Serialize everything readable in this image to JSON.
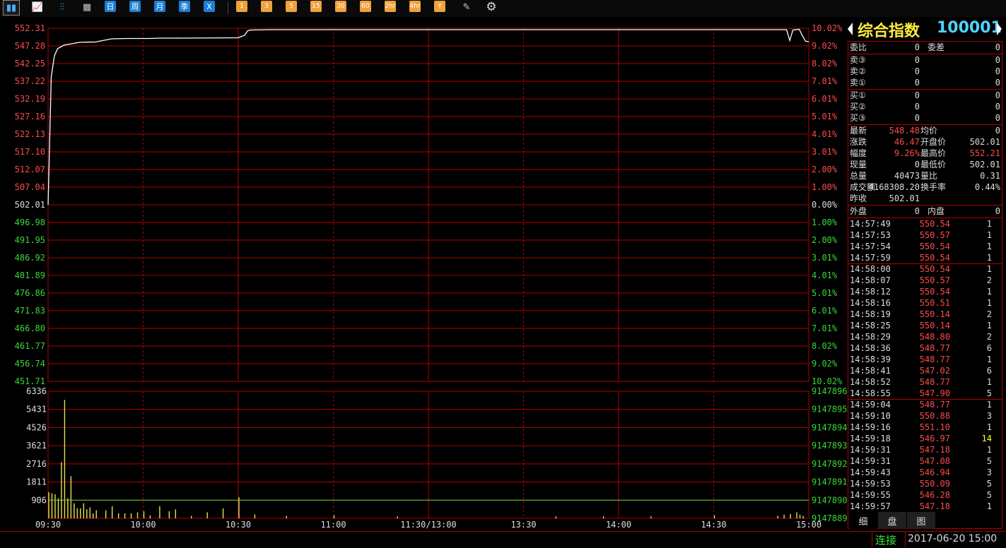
{
  "toolbar": {
    "items": [
      {
        "name": "bar-chart-icon",
        "label": "▮▮",
        "kind": "icon"
      },
      {
        "name": "line-chart-icon",
        "label": "📈",
        "kind": "icon"
      },
      {
        "name": "candlestick-icon",
        "label": "⫶⫶",
        "kind": "icon"
      },
      {
        "name": "calendar-icon",
        "label": "▦",
        "kind": "icon"
      },
      {
        "name": "period-day-button",
        "label": "日",
        "kind": "blue"
      },
      {
        "name": "period-week-button",
        "label": "周",
        "kind": "blue"
      },
      {
        "name": "period-month-button",
        "label": "月",
        "kind": "blue"
      },
      {
        "name": "period-quarter-button",
        "label": "季",
        "kind": "blue"
      },
      {
        "name": "period-x-button",
        "label": "X",
        "kind": "blue"
      },
      {
        "name": "period-1min-button",
        "label": "1",
        "kind": "orange"
      },
      {
        "name": "period-3min-button",
        "label": "3",
        "kind": "orange"
      },
      {
        "name": "period-5min-button",
        "label": "5",
        "kind": "orange"
      },
      {
        "name": "period-15min-button",
        "label": "15",
        "kind": "orange"
      },
      {
        "name": "period-30min-button",
        "label": "30",
        "kind": "orange"
      },
      {
        "name": "period-60min-button",
        "label": "60",
        "kind": "orange"
      },
      {
        "name": "period-2hr-button",
        "label": "2hr",
        "kind": "orange"
      },
      {
        "name": "period-4hr-button",
        "label": "4hr",
        "kind": "orange"
      },
      {
        "name": "period-year-button",
        "label": "Y",
        "kind": "orange"
      },
      {
        "name": "edit-icon",
        "label": "✎",
        "kind": "icon"
      },
      {
        "name": "gear-icon",
        "label": "⚙",
        "kind": "icon"
      }
    ]
  },
  "chart_data": [
    {
      "type": "line",
      "y_left_ticks": [
        "552.31",
        "547.28",
        "542.25",
        "537.22",
        "532.19",
        "527.16",
        "522.13",
        "517.10",
        "512.07",
        "507.04",
        "502.01",
        "496.98",
        "491.95",
        "486.92",
        "481.89",
        "476.86",
        "471.83",
        "466.80",
        "461.77",
        "456.74",
        "451.71"
      ],
      "y_right_ticks": [
        "10.02%",
        "9.02%",
        "8.02%",
        "7.01%",
        "6.01%",
        "5.01%",
        "4.01%",
        "3.01%",
        "2.00%",
        "1.00%",
        "0.00%",
        "1.00%",
        "2.00%",
        "3.01%",
        "4.01%",
        "5.01%",
        "6.01%",
        "7.01%",
        "8.02%",
        "9.02%",
        "10.02%"
      ],
      "ylim": [
        451.71,
        552.31
      ],
      "base_price": 502.01,
      "minutes": [
        0,
        1,
        2,
        3,
        5,
        7,
        10,
        15,
        20,
        25,
        30,
        32,
        35,
        40,
        60,
        62,
        63,
        64,
        70,
        90,
        120,
        150,
        180,
        195,
        200,
        210,
        230,
        233,
        234,
        235,
        237,
        238,
        239,
        240
      ],
      "prices": [
        502.01,
        538.5,
        544.5,
        546.5,
        547.5,
        547.8,
        548.3,
        548.4,
        549.3,
        549.4,
        549.4,
        549.4,
        549.5,
        549.5,
        549.6,
        550.3,
        551.6,
        551.8,
        551.9,
        551.9,
        551.9,
        551.9,
        551.9,
        551.9,
        551.9,
        551.9,
        551.9,
        551.9,
        548.8,
        551.8,
        552.0,
        550.2,
        548.6,
        548.48
      ]
    },
    {
      "type": "bar",
      "y_left_ticks": [
        "6336",
        "5431",
        "4526",
        "3621",
        "2716",
        "1811",
        "906"
      ],
      "y_right_ticks": [
        "9147896",
        "9147895",
        "9147894",
        "9147893",
        "9147892",
        "9147891",
        "9147890",
        "9147889"
      ],
      "ylim": [
        0,
        6336
      ],
      "bar_minutes": [
        0,
        1,
        2,
        3,
        4,
        5,
        6,
        7,
        8,
        9,
        10,
        11,
        12,
        13,
        14,
        15,
        18,
        20,
        22,
        24,
        26,
        28,
        30,
        32,
        35,
        38,
        40,
        45,
        50,
        55,
        60,
        65,
        75,
        90,
        110,
        160,
        175,
        190,
        210,
        230,
        232,
        234,
        236,
        237,
        238
      ],
      "bar_values": [
        1300,
        1250,
        1200,
        1000,
        2800,
        5900,
        1000,
        2100,
        750,
        500,
        500,
        750,
        450,
        550,
        250,
        400,
        400,
        600,
        250,
        250,
        250,
        300,
        350,
        150,
        600,
        350,
        450,
        120,
        300,
        500,
        1050,
        200,
        120,
        150,
        100,
        100,
        100,
        100,
        150,
        130,
        180,
        220,
        300,
        180,
        120
      ],
      "avg_line_value": 905,
      "x_ticks": [
        "09:30",
        "10:00",
        "10:30",
        "11:00",
        "11:30/13:00",
        "13:30",
        "14:00",
        "14:30",
        "15:00"
      ]
    }
  ],
  "quote": {
    "name": "综合指数",
    "code": "100001",
    "weibi_label": "委比",
    "weibi_value": "0",
    "weicha_label": "委差",
    "weicha_value": "0",
    "asks": [
      {
        "label": "卖③",
        "price": "0",
        "vol": "0"
      },
      {
        "label": "卖②",
        "price": "0",
        "vol": "0"
      },
      {
        "label": "卖①",
        "price": "0",
        "vol": "0"
      }
    ],
    "bids": [
      {
        "label": "买①",
        "price": "0",
        "vol": "0"
      },
      {
        "label": "买②",
        "price": "0",
        "vol": "0"
      },
      {
        "label": "买③",
        "price": "0",
        "vol": "0"
      }
    ],
    "stats": [
      {
        "l1": "最新",
        "v1": "548.48",
        "c1": "red",
        "l2": "均价",
        "v2": "0",
        "c2": "wht"
      },
      {
        "l1": "涨跌",
        "v1": "46.47",
        "c1": "red",
        "l2": "开盘价",
        "v2": "502.01",
        "c2": "wht"
      },
      {
        "l1": "幅度",
        "v1": "9.26%",
        "c1": "red",
        "l2": "最高价",
        "v2": "552.21",
        "c2": "red"
      },
      {
        "l1": "现量",
        "v1": "0",
        "c1": "wht",
        "l2": "最低价",
        "v2": "502.01",
        "c2": "wht"
      },
      {
        "l1": "总量",
        "v1": "40473",
        "c1": "wht",
        "l2": "量比",
        "v2": "0.31",
        "c2": "wht"
      },
      {
        "l1": "成交额",
        "v1": "4168308.20",
        "c1": "wht",
        "l2": "换手率",
        "v2": "0.44%",
        "c2": "wht"
      },
      {
        "l1": "昨收",
        "v1": "502.01",
        "c1": "wht",
        "l2": "",
        "v2": "",
        "c2": "wht"
      }
    ],
    "outer_label": "外盘",
    "outer_value": "0",
    "inner_label": "内盘",
    "inner_value": "0",
    "ticks": [
      {
        "t": "14:57:49",
        "p": "550.54",
        "v": "1",
        "vc": "wht"
      },
      {
        "t": "14:57:53",
        "p": "550.57",
        "v": "1",
        "vc": "wht"
      },
      {
        "t": "14:57:54",
        "p": "550.54",
        "v": "1",
        "vc": "wht"
      },
      {
        "t": "14:57:59",
        "p": "550.54",
        "v": "1",
        "vc": "wht"
      },
      {
        "t": "14:58:00",
        "p": "550.54",
        "v": "1",
        "vc": "wht"
      },
      {
        "t": "14:58:07",
        "p": "550.57",
        "v": "2",
        "vc": "wht"
      },
      {
        "t": "14:58:12",
        "p": "550.54",
        "v": "1",
        "vc": "wht"
      },
      {
        "t": "14:58:16",
        "p": "550.51",
        "v": "1",
        "vc": "wht"
      },
      {
        "t": "14:58:19",
        "p": "550.14",
        "v": "2",
        "vc": "wht"
      },
      {
        "t": "14:58:25",
        "p": "550.14",
        "v": "1",
        "vc": "wht"
      },
      {
        "t": "14:58:29",
        "p": "548.80",
        "v": "2",
        "vc": "wht"
      },
      {
        "t": "14:58:36",
        "p": "548.77",
        "v": "6",
        "vc": "wht"
      },
      {
        "t": "14:58:39",
        "p": "548.77",
        "v": "1",
        "vc": "wht"
      },
      {
        "t": "14:58:41",
        "p": "547.02",
        "v": "6",
        "vc": "wht"
      },
      {
        "t": "14:58:52",
        "p": "548.77",
        "v": "1",
        "vc": "wht"
      },
      {
        "t": "14:58:55",
        "p": "547.90",
        "v": "5",
        "vc": "wht"
      },
      {
        "t": "14:59:04",
        "p": "548.77",
        "v": "1",
        "vc": "wht"
      },
      {
        "t": "14:59:10",
        "p": "550.88",
        "v": "3",
        "vc": "wht"
      },
      {
        "t": "14:59:16",
        "p": "551.10",
        "v": "1",
        "vc": "wht"
      },
      {
        "t": "14:59:18",
        "p": "546.97",
        "v": "14",
        "vc": "yel"
      },
      {
        "t": "14:59:31",
        "p": "547.18",
        "v": "1",
        "vc": "wht"
      },
      {
        "t": "14:59:31",
        "p": "547.08",
        "v": "5",
        "vc": "wht"
      },
      {
        "t": "14:59:43",
        "p": "546.94",
        "v": "3",
        "vc": "wht"
      },
      {
        "t": "14:59:53",
        "p": "550.09",
        "v": "5",
        "vc": "wht"
      },
      {
        "t": "14:59:55",
        "p": "546.28",
        "v": "5",
        "vc": "wht"
      },
      {
        "t": "14:59:57",
        "p": "547.18",
        "v": "1",
        "vc": "wht"
      }
    ]
  },
  "tabs": [
    {
      "name": "tab-detail",
      "label": "细",
      "active": true
    },
    {
      "name": "tab-order",
      "label": "盘",
      "active": false
    },
    {
      "name": "tab-chart",
      "label": "图",
      "active": false
    }
  ],
  "status": {
    "connection": "连接",
    "datetime": "2017-06-20 15:00"
  },
  "colors": {
    "grid": "#b00000",
    "price_line": "#ffffff",
    "avg_line": "#44dd44",
    "volume_bar": "#e8e24a",
    "up": "#ff4a4a",
    "down": "#38d838"
  }
}
